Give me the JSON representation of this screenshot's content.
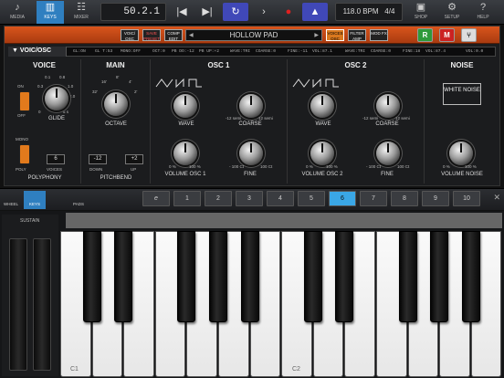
{
  "toolbar": {
    "media": "MEDIA",
    "keys": "KEYS",
    "mixer": "MIXER",
    "position": "50.2.1",
    "tempo": "118.0 BPM",
    "signature": "4/4",
    "shop": "SHOP",
    "setup": "SETUP",
    "help": "HELP"
  },
  "header": {
    "voic_osc_btn": "VOIC/ OSC",
    "save": "SAVE PRESET",
    "comp": "COMP EDIT",
    "preset_name": "HOLLOW PAD",
    "voices_osc": "VOICES OSC",
    "filter_amp": "FILTER AMP",
    "mod_fx": "MOD FX",
    "btn_r": "R",
    "btn_m": "M"
  },
  "status": {
    "module": "VOIC/OSC",
    "gl": "GL:ON",
    "glt": "GL T:53",
    "mono": "MONO:OFF",
    "oct": "OCT:0",
    "pbdo": "PB DO:-12",
    "pbup": "PB UP:+2",
    "wave1": "WAVE:TRI",
    "coarse1": "COARSE:0",
    "fine1": "FINE:-11",
    "vol1": "VOL:87.1",
    "wave2": "WAVE:TRI",
    "coarse2": "COARSE:0",
    "fine2": "FINE:18",
    "vol2": "VOL:87.4",
    "volN": "VOL:0.0"
  },
  "voice": {
    "title": "VOICE",
    "on": "ON",
    "off": "OFF",
    "glide": "GLIDE",
    "mono": "MONO",
    "poly": "POLY",
    "voices": "6",
    "voices_label": "VOICES",
    "polyphony": "POLYPHONY",
    "glide_scale": [
      "0.1",
      "0.3",
      "0.8",
      "1.0",
      "2.0",
      "0",
      "5 s"
    ]
  },
  "main": {
    "title": "MAIN",
    "octave": "OCTAVE",
    "oct_scale": [
      "32'",
      "16'",
      "8'",
      "4'",
      "2'"
    ],
    "down": "-12",
    "up": "+2",
    "down_label": "DOWN",
    "up_label": "UP",
    "pitchbend": "PITCHBEND"
  },
  "osc1": {
    "title": "OSC 1",
    "wave": "WAVE",
    "coarse": "COARSE",
    "volume": "VOLUME OSC 1",
    "fine": "FINE",
    "coarse_min": "-12 semi",
    "coarse_max": "12 semi",
    "vol_min": "0 %",
    "vol_max": "100 %",
    "fine_min": "- 100 Ct",
    "fine_max": "100 Ct"
  },
  "osc2": {
    "title": "OSC 2",
    "wave": "WAVE",
    "coarse": "COARSE",
    "volume": "VOLUME OSC 2",
    "fine": "FINE",
    "coarse_min": "-12 semi",
    "coarse_max": "12 semi",
    "vol_min": "0 %",
    "vol_max": "100 %",
    "fine_min": "- 100 Ct",
    "fine_max": "100 Ct"
  },
  "noise": {
    "title": "NOISE",
    "type": "WHITE NOISE",
    "volume": "VOLUME NOISE",
    "vol_min": "0 %",
    "vol_max": "100 %"
  },
  "keybar": {
    "wheel": "WHEEL",
    "keys": "KEYS",
    "pads": "PADS",
    "octaves": [
      "1",
      "2",
      "3",
      "4",
      "5",
      "6",
      "7",
      "8",
      "9",
      "10"
    ],
    "selected": "6",
    "sustain": "SUSTAIN"
  },
  "keyboard": {
    "c1": "C1",
    "c2": "C2"
  }
}
